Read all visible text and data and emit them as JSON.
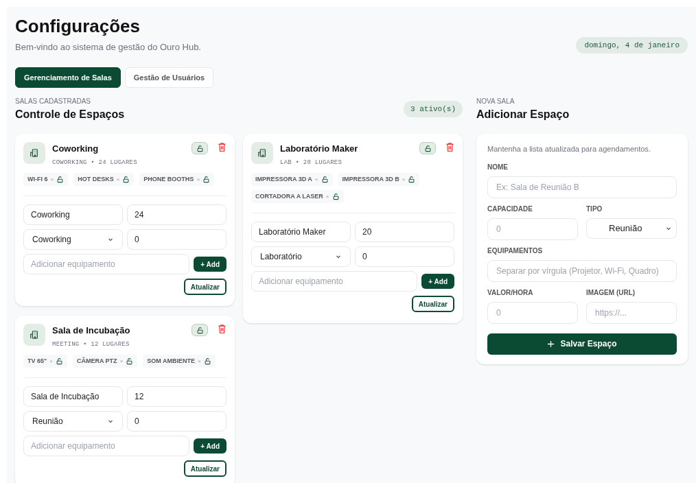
{
  "header": {
    "title": "Configurações",
    "subtitle": "Bem-vindo ao sistema de gestão do Ouro Hub.",
    "date": "domingo, 4 de janeiro"
  },
  "tabs": [
    {
      "label": "Gerenciamento de Salas",
      "selected": true
    },
    {
      "label": "Gestão de Usuários",
      "selected": false
    }
  ],
  "rooms_section": {
    "eyebrow": "SALAS CADASTRADAS",
    "title": "Controle de Espaços",
    "count": "3 ativo(s)"
  },
  "rooms": [
    {
      "title": "Coworking",
      "subtitle": "COWORKING • 24 LUGARES",
      "tags": [
        {
          "label": "WI-FI 6",
          "remove": "×"
        },
        {
          "label": "HOT DESKS",
          "remove": "×"
        },
        {
          "label": "PHONE BOOTHS",
          "remove": "×"
        }
      ],
      "name": "Coworking",
      "capacity": "24",
      "type": "Coworking",
      "price": "0",
      "equipment_placeholder": "Adicionar equipamento",
      "add": "+ Add",
      "update": "Atualizar"
    },
    {
      "title": "Laboratório Maker",
      "subtitle": "LAB • 20 LUGARES",
      "tags": [
        {
          "label": "IMPRESSORA 3D A",
          "remove": "×"
        },
        {
          "label": "IMPRESSORA 3D B",
          "remove": "×"
        },
        {
          "label": "CORTADORA A LASER",
          "remove": "×"
        }
      ],
      "name": "Laboratório Maker",
      "capacity": "20",
      "type": "Laboratório",
      "price": "0",
      "equipment_placeholder": "Adicionar equipamento",
      "add": "+ Add",
      "update": "Atualizar"
    },
    {
      "title": "Sala de Incubação",
      "subtitle": "MEETING • 12 LUGARES",
      "tags": [
        {
          "label": "TV 65\"",
          "remove": "×"
        },
        {
          "label": "CÂMERA PTZ",
          "remove": "×"
        },
        {
          "label": "SOM AMBIENTE",
          "remove": "×"
        }
      ],
      "name": "Sala de Incubação",
      "capacity": "12",
      "type": "Reunião",
      "price": "0",
      "equipment_placeholder": "Adicionar equipamento",
      "add": "+ Add",
      "update": "Atualizar"
    }
  ],
  "new_room": {
    "eyebrow": "NOVA SALA",
    "title": "Adicionar Espaço",
    "hint": "Mantenha a lista atualizada para agendamentos.",
    "rows": [
      [
        {
          "kind": "input",
          "label": "NOME",
          "placeholder": "Ex: Sala de Reunião B"
        }
      ],
      [
        {
          "kind": "input",
          "label": "CAPACIDADE",
          "placeholder": "0"
        },
        {
          "kind": "select",
          "label": "TIPO",
          "value": "Reunião"
        }
      ],
      [
        {
          "kind": "input",
          "label": "EQUIPAMENTOS",
          "placeholder": "Separar por vírgula (Projetor, Wi-Fi, Quadro)"
        }
      ],
      [
        {
          "kind": "input",
          "label": "VALOR/HORA",
          "placeholder": "0"
        },
        {
          "kind": "input",
          "label": "IMAGEM (URL)",
          "placeholder": "https://..."
        }
      ]
    ],
    "save": "Salvar Espaço"
  }
}
